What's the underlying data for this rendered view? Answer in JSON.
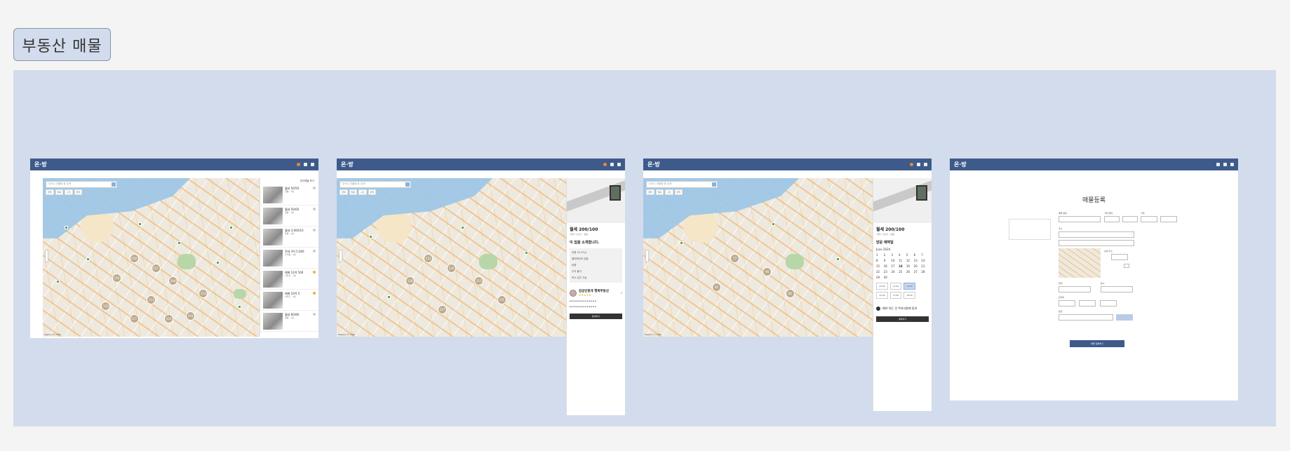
{
  "page": {
    "title": "부동산 매물"
  },
  "app": {
    "logo": "온·방"
  },
  "map": {
    "search_placeholder": "주소나 건물명 등 검색",
    "chips": [
      "금액",
      "방종",
      "구조",
      "면적"
    ],
    "footer": "Mapbox © OSM",
    "clusters": [
      "158",
      "162",
      "157",
      "240",
      "153",
      "113",
      "111",
      "217",
      "124",
      "104",
      "151",
      "126",
      "128",
      "115",
      "227",
      "131",
      "77",
      "90",
      "81",
      "68"
    ]
  },
  "screen1": {
    "list_header": "추천매물 보기",
    "items": [
      {
        "title": "월세 50/50",
        "sub": "원룸 · 3층"
      },
      {
        "title": "월세 50/60",
        "sub": "원룸 · 2층"
      },
      {
        "title": "월세 3,000/10",
        "sub": "투룸 · 4층"
      },
      {
        "title": "전세 3억 5,000",
        "sub": "쓰리룸 · 5층"
      },
      {
        "title": "매매 12억 500",
        "sub": "아파트 · 7층"
      },
      {
        "title": "매매 10억 5",
        "sub": "아파트 · 3층"
      },
      {
        "title": "월세 60/80",
        "sub": "원룸 · 1층"
      }
    ]
  },
  "screen2": {
    "title": "월세 200/100",
    "sub": "서울시 강남구 · 원룸",
    "section": "이 집을 소개합니다.",
    "options": [
      "전용 33.33㎡",
      "엘리베이터 있음",
      "남향",
      "주차 불가",
      "즉시 입주 가능"
    ],
    "agent_name": "김공인중개 행복부동산",
    "agent_stars": "★★★★★",
    "button": "문의하기"
  },
  "screen3": {
    "title": "월세 200/100",
    "sub": "서울시 강남구 · 원룸",
    "section": "방문 예약일",
    "month": "June 2024",
    "days": [
      "1",
      "2",
      "3",
      "4",
      "5",
      "6",
      "7",
      "8",
      "9",
      "10",
      "11",
      "12",
      "13",
      "14",
      "15",
      "16",
      "17",
      "18",
      "19",
      "20",
      "21",
      "22",
      "23",
      "24",
      "25",
      "26",
      "27",
      "28",
      "29",
      "30"
    ],
    "times": [
      "10:00",
      "11:00",
      "14:00",
      "15:00",
      "17:00",
      "18:00"
    ],
    "confirm": "예약 하는 것 주의사항에 동의",
    "button": "예약하기"
  },
  "screen4": {
    "title": "매물등록",
    "fields": [
      "매물 종류",
      "거래 형태",
      "가격",
      "주소",
      "상세 주소",
      "면적",
      "층수",
      "관리비",
      "옵션"
    ],
    "submit": "매물 등록하기"
  }
}
